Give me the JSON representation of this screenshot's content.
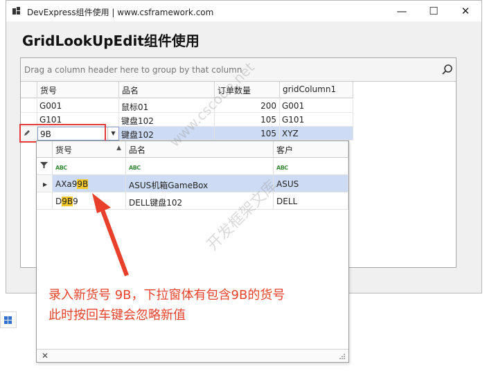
{
  "window": {
    "title": "DevExpress组件使用 | www.csframework.com",
    "heading": "GridLookUpEdit组件使用",
    "minimize_glyph": "—",
    "maximize_glyph": "☐",
    "close_glyph": "✕"
  },
  "grid": {
    "group_panel_text": "Drag a column header here to group by that column",
    "columns": [
      "货号",
      "品名",
      "订单数量",
      "gridColumn1"
    ],
    "rows": [
      {
        "code": "G001",
        "name": "鼠标01",
        "qty": "200",
        "col1": "G001"
      },
      {
        "code": "G101",
        "name": "键盘102",
        "qty": "105",
        "col1": "G101"
      }
    ],
    "editing_row": {
      "code": "9B",
      "name": "键盘102",
      "qty": "105",
      "col1": "XYZ"
    }
  },
  "popup": {
    "columns": [
      "货号",
      "品名",
      "客户"
    ],
    "filter_icon_text": "ABC",
    "rows": [
      {
        "code_pre": "AXa9",
        "code_hl": "9B",
        "code_post": "",
        "name": "ASUS机箱GameBox",
        "customer": "ASUS"
      },
      {
        "code_pre": "D",
        "code_hl": "9B",
        "code_post": "9",
        "name": "DELL键盘102",
        "customer": "DELL"
      }
    ],
    "close_glyph": "✕"
  },
  "annotation": {
    "line1": "录入新货号 9B，下拉窗体有包含9B的货号",
    "line2": "此时按回车键会忽略新值"
  },
  "watermark": {
    "line1": "www.cscode.net",
    "line2": "开发框架文库"
  },
  "colors": {
    "annotation": "#e8402a",
    "highlight": "#f6c829",
    "selected_row": "#cddcf4"
  }
}
